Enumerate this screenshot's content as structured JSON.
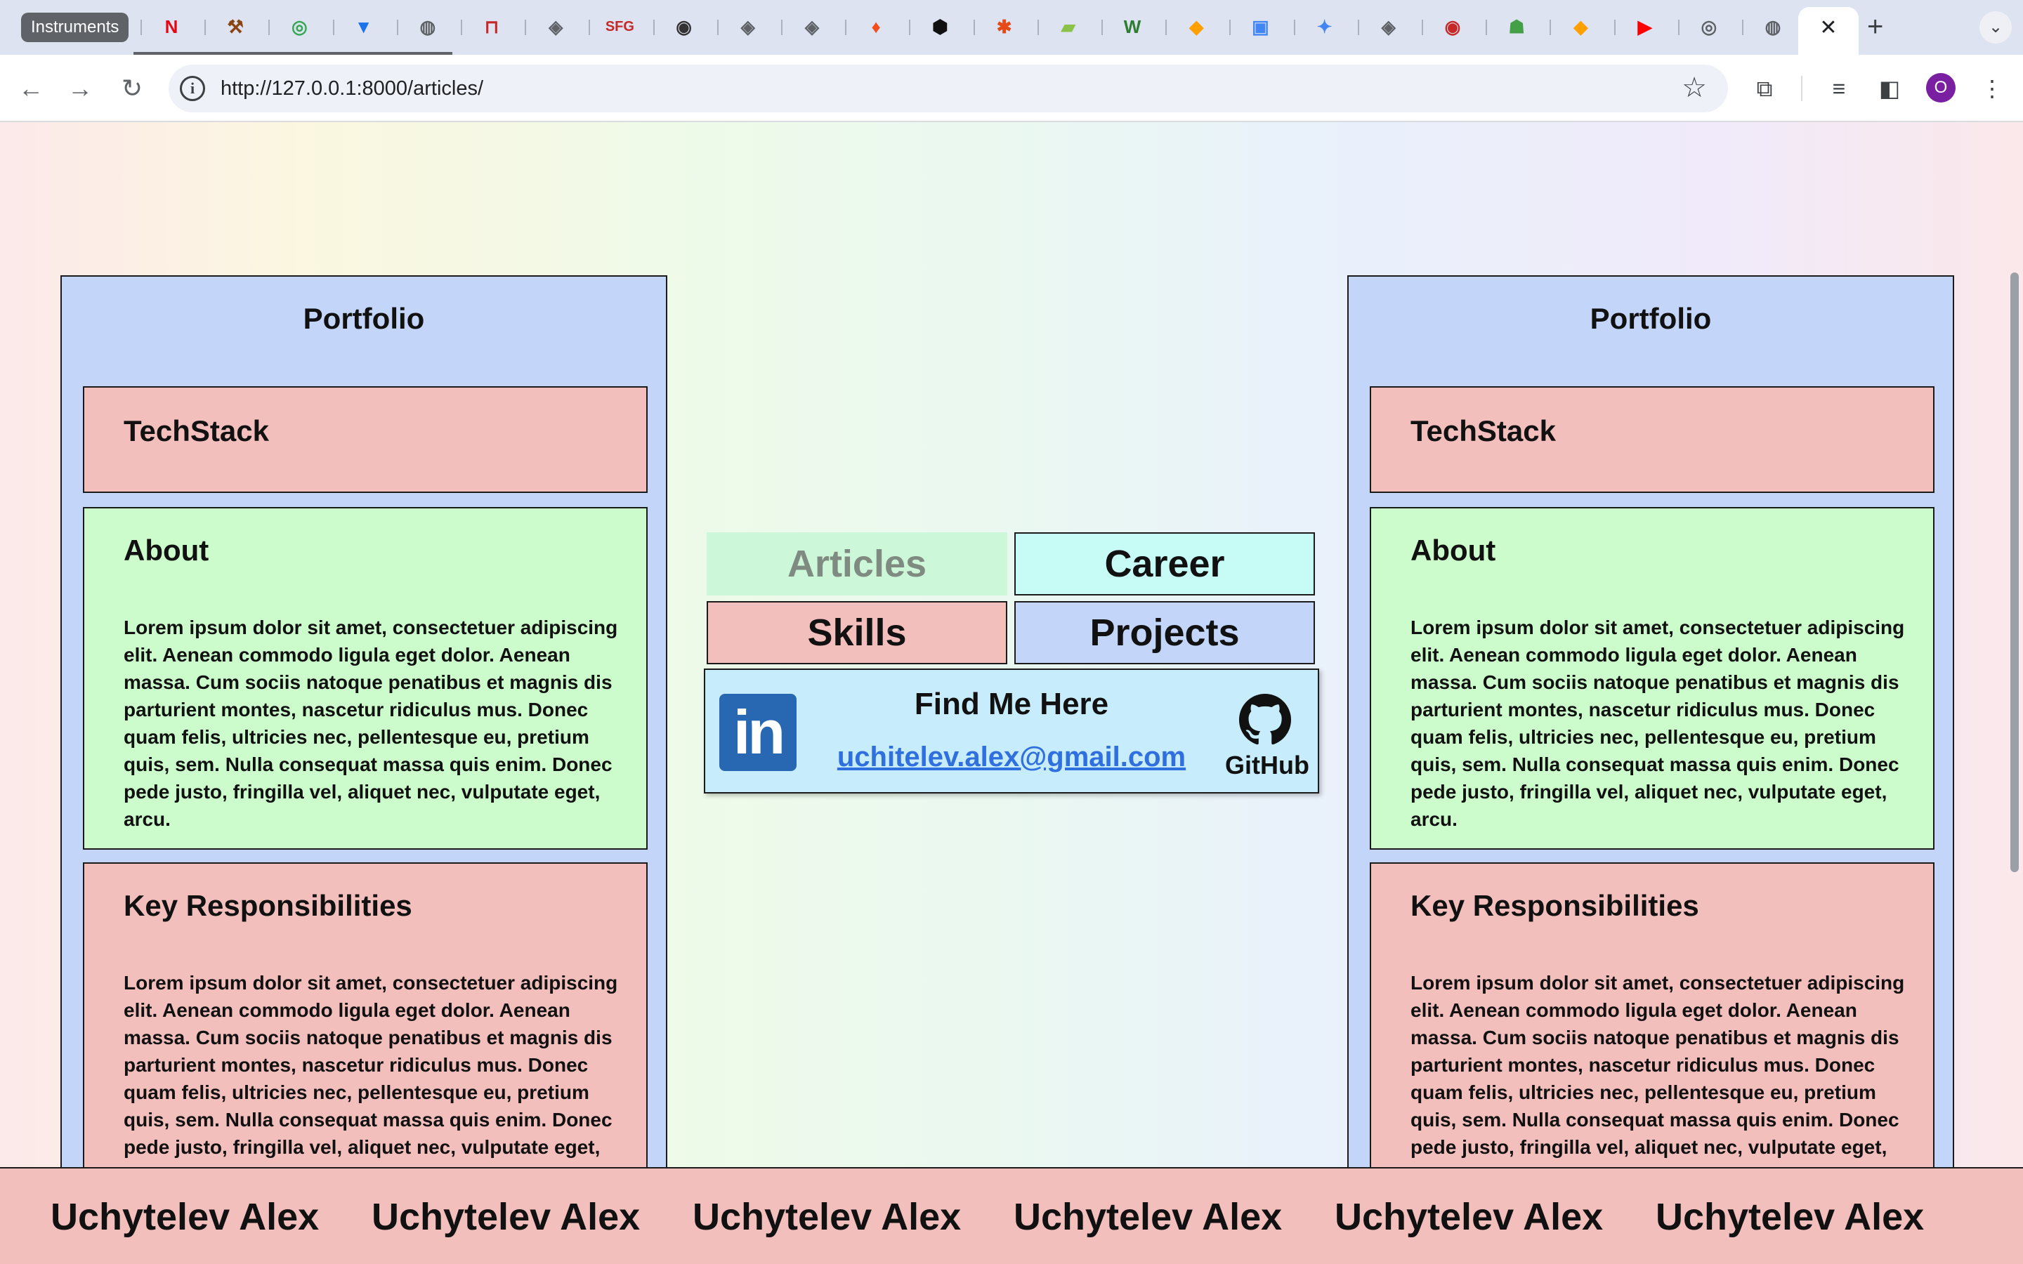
{
  "browser": {
    "first_tab_label": "Instruments",
    "url": "http://127.0.0.1:8000/articles/",
    "profile_initial": "O",
    "favicons": [
      "N",
      "⚒",
      "◎",
      "▼",
      "◍",
      "⊓",
      "◈",
      "SFG",
      "◉",
      "◈",
      "◈",
      "♦",
      "⬢",
      "✱",
      "▰",
      "W",
      "◆",
      "▣",
      "✦",
      "◈",
      "◉",
      "☗",
      "◆",
      "▶",
      "◎",
      "◍"
    ]
  },
  "panels": [
    {
      "title": "Portfolio",
      "techstack": "TechStack",
      "about_title": "About",
      "about_text": "Lorem ipsum dolor sit amet, consectetuer adipiscing elit. Aenean commodo ligula eget dolor. Aenean massa. Cum sociis natoque penatibus et magnis dis parturient montes, nascetur ridiculus mus. Donec quam felis, ultricies nec, pellentesque eu, pretium quis, sem. Nulla consequat massa quis enim. Donec pede justo, fringilla vel, aliquet nec, vulputate eget, arcu.",
      "resp_title": "Key Responsibilities",
      "resp_text": "Lorem ipsum dolor sit amet, consectetuer adipiscing elit. Aenean commodo ligula eget dolor. Aenean massa. Cum sociis natoque penatibus et magnis dis parturient montes, nascetur ridiculus mus. Donec quam felis, ultricies nec, pellentesque eu, pretium quis, sem. Nulla consequat massa quis enim. Donec pede justo, fringilla vel, aliquet nec, vulputate eget,"
    },
    {
      "title": "Portfolio",
      "techstack": "TechStack",
      "about_title": "About",
      "about_text": "Lorem ipsum dolor sit amet, consectetuer adipiscing elit. Aenean commodo ligula eget dolor. Aenean massa. Cum sociis natoque penatibus et magnis dis parturient montes, nascetur ridiculus mus. Donec quam felis, ultricies nec, pellentesque eu, pretium quis, sem. Nulla consequat massa quis enim. Donec pede justo, fringilla vel, aliquet nec, vulputate eget, arcu.",
      "resp_title": "Key Responsibilities",
      "resp_text": "Lorem ipsum dolor sit amet, consectetuer adipiscing elit. Aenean commodo ligula eget dolor. Aenean massa. Cum sociis natoque penatibus et magnis dis parturient montes, nascetur ridiculus mus. Donec quam felis, ultricies nec, pellentesque eu, pretium quis, sem. Nulla consequat massa quis enim. Donec pede justo, fringilla vel, aliquet nec, vulputate eget,"
    }
  ],
  "nav": {
    "articles": "Articles",
    "career": "Career",
    "skills": "Skills",
    "projects": "Projects",
    "active": "Articles"
  },
  "contact": {
    "title": "Find Me Here",
    "email": "uchitelev.alex@gmail.com",
    "linkedin_logo": "in",
    "github_label": "GitHub"
  },
  "footer": {
    "items": [
      "Uchytelev Alex",
      "Uchytelev Alex",
      "Uchytelev Alex",
      "Uchytelev Alex",
      "Uchytelev Alex",
      "Uchytelev Alex"
    ]
  }
}
